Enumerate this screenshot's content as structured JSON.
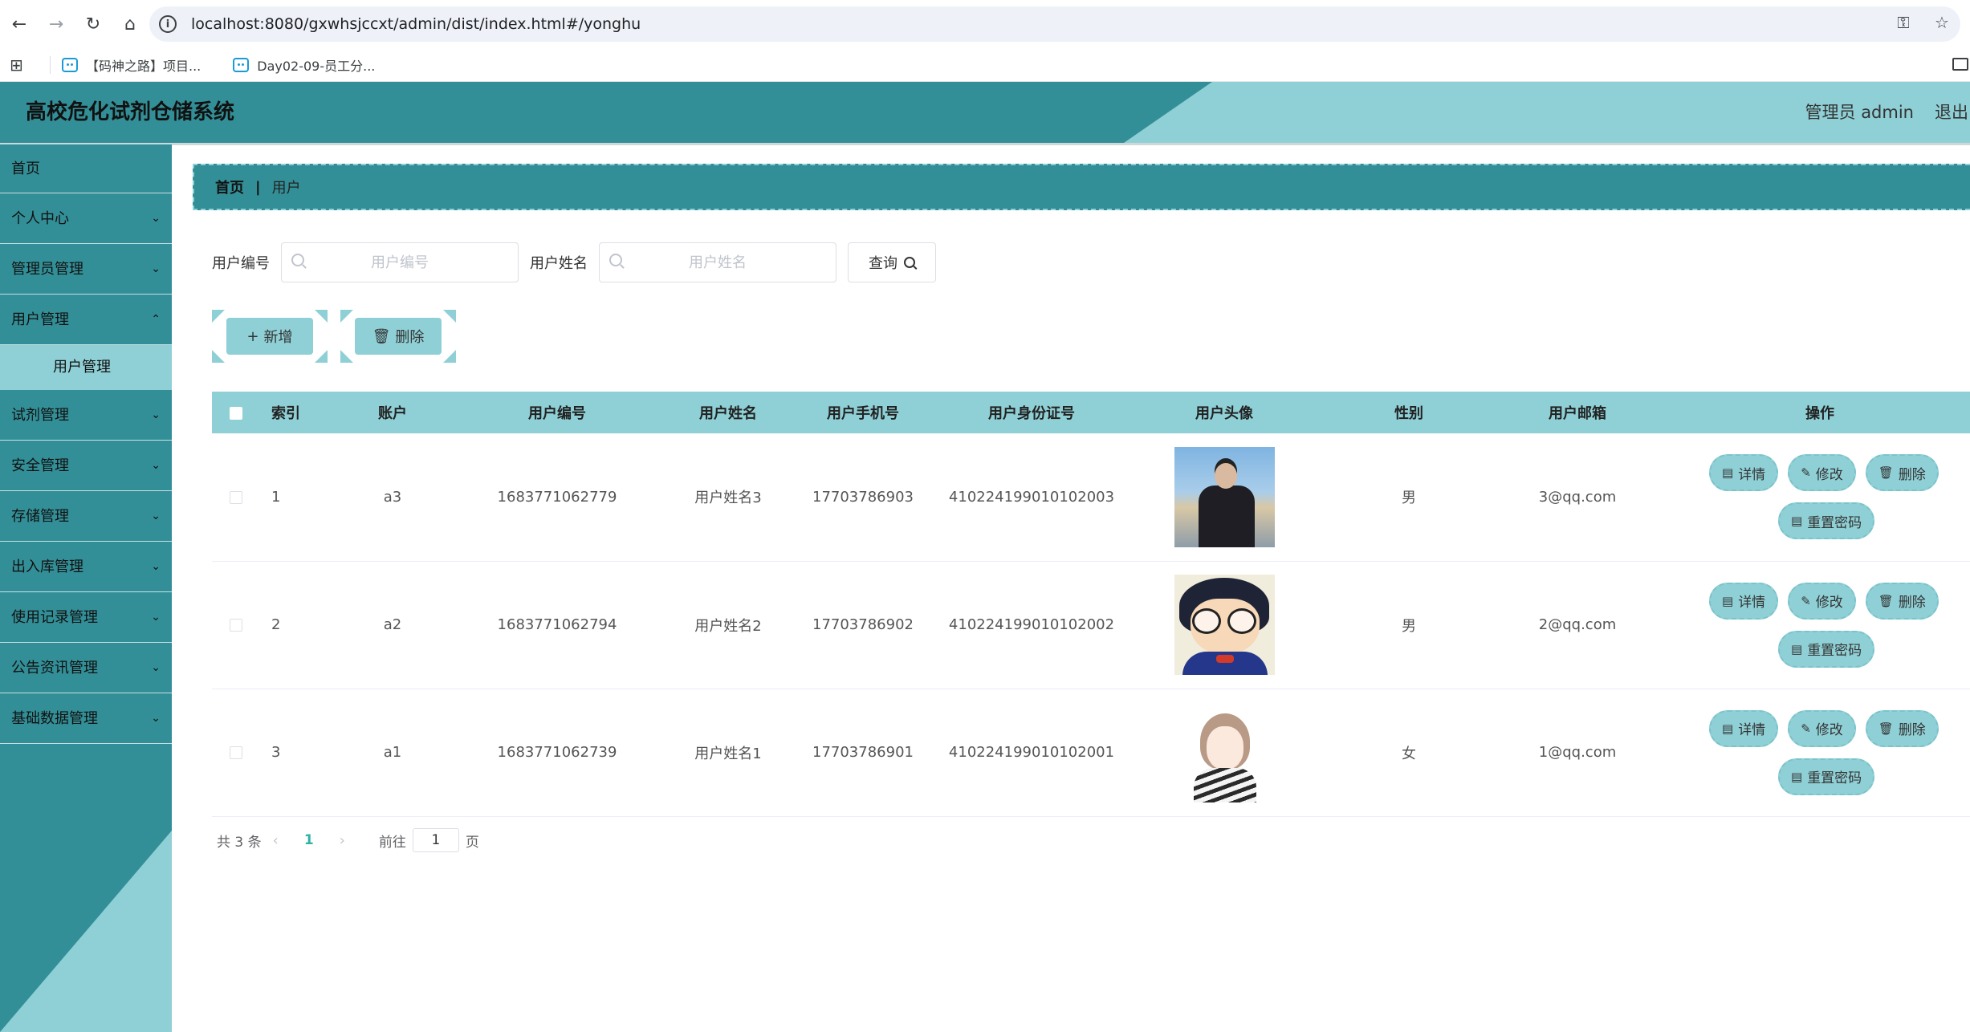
{
  "browser": {
    "url": "localhost:8080/gxwhsjccxt/admin/dist/index.html#/yonghu",
    "bookmarks": [
      "【码神之路】项目...",
      "Day02-09-员工分..."
    ]
  },
  "header": {
    "title": "高校危化试剂仓储系统",
    "user": "管理员 admin",
    "logout": "退出"
  },
  "sidebar": {
    "home": "首页",
    "items": [
      {
        "label": "个人中心"
      },
      {
        "label": "管理员管理"
      },
      {
        "label": "用户管理",
        "sub": "用户管理"
      },
      {
        "label": "试剂管理"
      },
      {
        "label": "安全管理"
      },
      {
        "label": "存储管理"
      },
      {
        "label": "出入库管理"
      },
      {
        "label": "使用记录管理"
      },
      {
        "label": "公告资讯管理"
      },
      {
        "label": "基础数据管理"
      }
    ]
  },
  "breadcrumb": {
    "home": "首页",
    "current": "用户"
  },
  "search": {
    "label_no": "用户编号",
    "placeholder_no": "用户编号",
    "label_name": "用户姓名",
    "placeholder_name": "用户姓名",
    "query": "查询"
  },
  "actions": {
    "add": "新增",
    "delete": "删除"
  },
  "table": {
    "headers": [
      "索引",
      "账户",
      "用户编号",
      "用户姓名",
      "用户手机号",
      "用户身份证号",
      "用户头像",
      "性别",
      "用户邮箱",
      "操作"
    ],
    "rows": [
      {
        "index": "1",
        "account": "a3",
        "no": "1683771062779",
        "name": "用户姓名3",
        "phone": "17703786903",
        "idcard": "410224199010102003",
        "gender": "男",
        "email": "3@qq.com"
      },
      {
        "index": "2",
        "account": "a2",
        "no": "1683771062794",
        "name": "用户姓名2",
        "phone": "17703786902",
        "idcard": "410224199010102002",
        "gender": "男",
        "email": "2@qq.com"
      },
      {
        "index": "3",
        "account": "a1",
        "no": "1683771062739",
        "name": "用户姓名1",
        "phone": "17703786901",
        "idcard": "410224199010102001",
        "gender": "女",
        "email": "1@qq.com"
      }
    ],
    "ops": {
      "detail": "详情",
      "edit": "修改",
      "delete": "删除",
      "reset": "重置密码"
    }
  },
  "pagination": {
    "total": "共 3 条",
    "current": "1",
    "goto": "前往",
    "page_value": "1",
    "page_unit": "页"
  },
  "colors": {
    "primary": "#338f97",
    "accent": "#8fd0d6",
    "active_page": "#2fb3a5"
  }
}
